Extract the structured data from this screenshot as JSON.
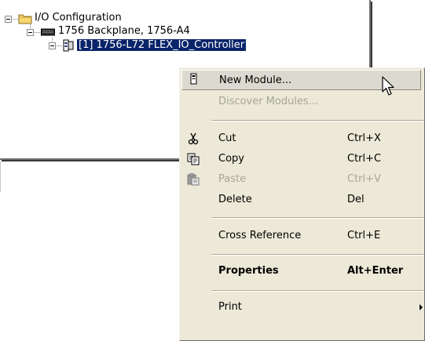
{
  "tree": {
    "items": [
      {
        "label": "I/O Configuration",
        "icon": "folder-icon"
      },
      {
        "label": "1756 Backplane, 1756-A4",
        "icon": "backplane-icon"
      },
      {
        "label": "[1] 1756-L72 FLEX_IO_Controller",
        "icon": "controller-icon",
        "selected": true
      }
    ]
  },
  "context_menu": {
    "items": [
      {
        "label": "New Module...",
        "shortcut": "",
        "icon": "module-icon",
        "state": "hover"
      },
      {
        "label": "Discover Modules...",
        "shortcut": "",
        "icon": "",
        "state": "disabled"
      },
      {
        "label": "Cut",
        "shortcut": "Ctrl+X",
        "icon": "scissors-icon",
        "state": "enabled"
      },
      {
        "label": "Copy",
        "shortcut": "Ctrl+C",
        "icon": "copy-icon",
        "state": "enabled"
      },
      {
        "label": "Paste",
        "shortcut": "Ctrl+V",
        "icon": "paste-icon",
        "state": "disabled"
      },
      {
        "label": "Delete",
        "shortcut": "Del",
        "icon": "",
        "state": "enabled"
      },
      {
        "label": "Cross Reference",
        "shortcut": "Ctrl+E",
        "icon": "",
        "state": "enabled"
      },
      {
        "label": "Properties",
        "shortcut": "Alt+Enter",
        "icon": "",
        "state": "bold"
      },
      {
        "label": "Print",
        "shortcut": "",
        "icon": "",
        "state": "submenu"
      }
    ]
  },
  "colors": {
    "selection": "#0a246a",
    "menu_background": "#ece9d8",
    "disabled_text": "#a7a59a"
  }
}
